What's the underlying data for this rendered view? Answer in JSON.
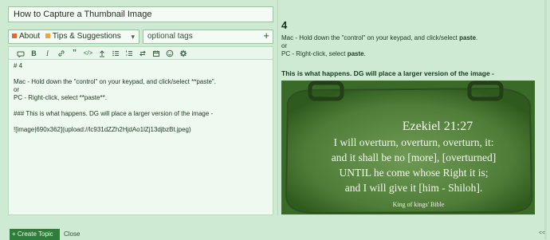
{
  "editor": {
    "title_value": "How to Capture a Thumbnail Image",
    "category": {
      "items": [
        "About",
        "Tips & Suggestions"
      ],
      "colors": [
        "#e06c2b",
        "#f2a33a"
      ]
    },
    "tags_placeholder": "optional tags",
    "toolbar_icons": [
      "quote-icon",
      "bold-icon",
      "italic-icon",
      "link-icon",
      "blockquote-icon",
      "code-icon",
      "upload-icon",
      "bullet-list-icon",
      "numbered-list-icon",
      "toggle-icon",
      "calendar-icon",
      "emoji-icon",
      "settings-icon"
    ],
    "content_lines": [
      "# 4",
      "",
      "Mac - Hold down the \"control\" on your keypad, and click/select **paste\".",
      "or",
      "PC - Right-click, select **paste**.",
      "",
      "### This is what happens. DG will place a larger version of the image -",
      "",
      "![image|690x362](upload://lc931dZZh2HjdAo1lZj13djbzBt.jpeg)"
    ],
    "create_label": "Create Topic",
    "close_label": "Close"
  },
  "preview": {
    "heading": "4",
    "mac_prefix": "Mac - Hold down the \"control\" on your keypad, and click/select ",
    "mac_bold": "paste",
    "mac_suffix": ".",
    "or_text": "or",
    "pc_prefix": "PC - Right-click, select ",
    "pc_bold": "paste",
    "pc_suffix": ".",
    "subheading": "This is what happens. DG will place a larger version of the image -",
    "image": {
      "verse_ref": "Ezekiel 21:27",
      "lines": [
        "I will overturn, overturn, overturn, it:",
        "and it shall be no [more], [overturned]",
        "UNTIL he come whose Right it is;",
        "and I will give it [him - Shiloh]."
      ],
      "credit": "King of kings' Bible"
    },
    "corner_marker": "<<"
  }
}
